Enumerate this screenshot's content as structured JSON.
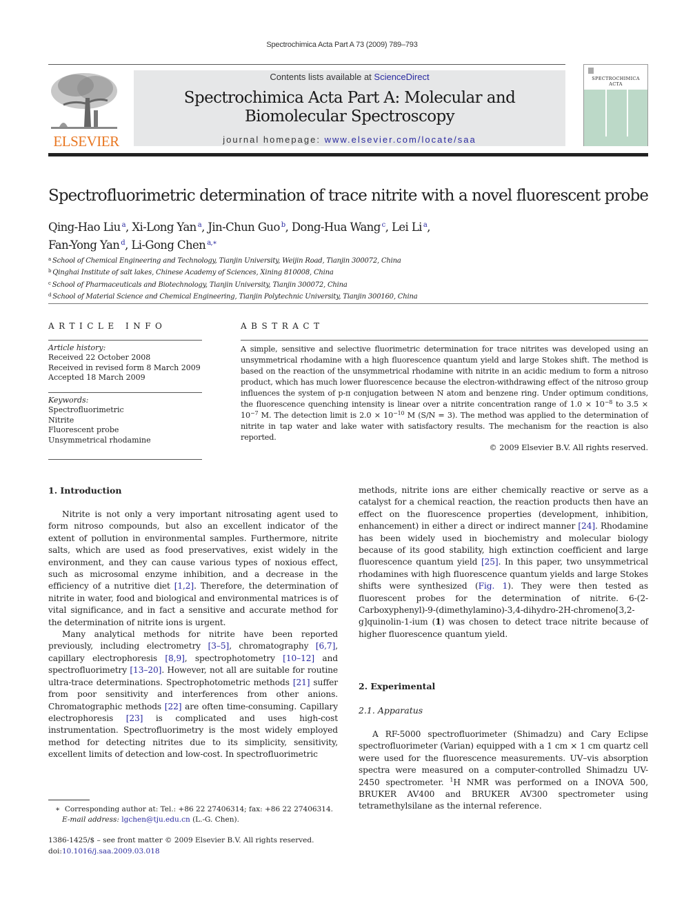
{
  "running_head": "Spectrochimica Acta Part A 73 (2009) 789–793",
  "publisher": {
    "logo_wordmark": "ELSEVIER",
    "brand_color": "#e87722"
  },
  "banner": {
    "contents_prefix": "Contents lists available at ",
    "contents_link": "ScienceDirect",
    "journal_title_line1": "Spectrochimica Acta Part A: Molecular and",
    "journal_title_line2": "Biomolecular Spectroscopy",
    "homepage_prefix": "journal homepage: ",
    "homepage_link": "www.elsevier.com/locate/saa",
    "background_color": "#e6e7e8",
    "link_color": "#2a2aa0"
  },
  "cover": {
    "title_line1": "SPECTROCHIMICA",
    "title_line2": "ACTA",
    "body_color": "#bcd9c8"
  },
  "article": {
    "title": "Spectrofluorimetric determination of trace nitrite with a novel fluorescent probe",
    "authors": [
      {
        "name": "Qing-Hao Liu",
        "aff": "a",
        "sep": ", "
      },
      {
        "name": "Xi-Long Yan",
        "aff": "a",
        "sep": ", "
      },
      {
        "name": "Jin-Chun Guo",
        "aff": "b",
        "sep": ", "
      },
      {
        "name": "Dong-Hua Wang",
        "aff": "c",
        "sep": ", "
      },
      {
        "name": "Lei Li",
        "aff": "a",
        "sep": ","
      },
      {
        "name": "Fan-Yong Yan",
        "aff": "d",
        "sep": ", "
      },
      {
        "name": "Li-Gong Chen",
        "aff": "a,∗",
        "sep": ""
      }
    ],
    "affiliations": [
      {
        "key": "a",
        "text": "School of Chemical Engineering and Technology, Tianjin University, Weijin Road, Tianjin 300072, China"
      },
      {
        "key": "b",
        "text": "Qinghai Institute of salt lakes, Chinese Academy of Sciences, Xining 810008, China"
      },
      {
        "key": "c",
        "text": "School of Pharmaceuticals and Biotechnology, Tianjin University, Tianjin 300072, China"
      },
      {
        "key": "d",
        "text": "School of Material Science and Chemical Engineering, Tianjin Polytechnic University, Tianjin 300160, China"
      }
    ]
  },
  "article_info": {
    "heading": "ARTICLE INFO",
    "history_label": "Article history:",
    "history": [
      "Received 22 October 2008",
      "Received in revised form 8 March 2009",
      "Accepted 18 March 2009"
    ],
    "keywords_label": "Keywords:",
    "keywords": [
      "Spectrofluorimetric",
      "Nitrite",
      "Fluorescent probe",
      "Unsymmetrical rhodamine"
    ]
  },
  "abstract": {
    "heading": "ABSTRACT",
    "text_part1": "A simple, sensitive and selective fluorimetric determination for trace nitrites was developed using an unsymmetrical rhodamine with a high fluorescence quantum yield and large Stokes shift. The method is based on the reaction of the unsymmetrical rhodamine with nitrite in an acidic medium to form a nitroso product, which has much lower fluorescence because the electron-withdrawing effect of the nitroso group influences the system of p-π conjugation between N atom and benzene ring. Under optimum conditions, the fluorescence quenching intensity is linear over a nitrite concentration range of 1.0 × 10",
    "exp1": "−8",
    "text_part2": " to 3.5 × 10",
    "exp2": "−7",
    "text_part3": " M. The detection limit is 2.0 × 10",
    "exp3": "−10",
    "text_part4": " M (S/N = 3). The method was applied to the determination of nitrite in tap water and lake water with satisfactory results. The mechanism for the reaction is also reported.",
    "copyright": "© 2009 Elsevier B.V. All rights reserved."
  },
  "body": {
    "section1_heading": "1.  Introduction",
    "intro_p1": {
      "a": "Nitrite is not only a very important nitrosating agent used to form nitroso compounds, but also an excellent indicator of the extent of pollution in environmental samples. Furthermore, nitrite salts, which are used as food preservatives, exist widely in the environment, and they can cause various types of noxious effect, such as microsomal enzyme inhibition, and a decrease in the efficiency of a nutritive diet ",
      "ref1": "[1,2]",
      "b": ". Therefore, the determination of nitrite in water, food and biological and environmental matrices is of vital significance, and in fact a sensitive and accurate method for the determination of nitrite ions is urgent."
    },
    "intro_p2": {
      "a": "Many analytical methods for nitrite have been reported previously, including electrometry ",
      "ref1": "[3–5]",
      "b": ", chromatography ",
      "ref2": "[6,7]",
      "c": ", capillary electrophoresis ",
      "ref3": "[8,9]",
      "d": ", spectrophotometry ",
      "ref4": "[10–12]",
      "e": " and spectrofluorimetry ",
      "ref5": "[13–20]",
      "f": ". However, not all are suitable for routine ultra-trace determinations. Spectrophotometric methods ",
      "ref6": "[21]",
      "g": " suffer from poor sensitivity and interferences from other anions. Chromatographic methods ",
      "ref7": "[22]",
      "h": " are often time-consuming. Capillary electrophoresis ",
      "ref8": "[23]",
      "i": " is complicated and uses high-cost instrumentation. Spectrofluorimetry is the most widely employed method for detecting nitrites due to its simplicity, sensitivity, excellent limits of detection and low-cost. In spectrofluorimetric"
    },
    "intro_p2_cont": {
      "a": "methods, nitrite ions are either chemically reactive or serve as a catalyst for a chemical reaction, the reaction products then have an effect on the fluorescence properties (development, inhibition, enhancement) in either a direct or indirect manner ",
      "ref1": "[24]",
      "b": ". Rhodamine has been widely used in biochemistry and molecular biology because of its good stability, high extinction coefficient and large fluorescence quantum yield ",
      "ref2": "[25]",
      "c": ". In this paper, two unsymmetrical rhodamines with high fluorescence quantum yields and large Stokes shifts were synthesized (",
      "ref3": "Fig. 1",
      "d": "). They were then tested as fluorescent probes for the determination of nitrite. 6-(2-Carboxyphenyl)-9-(dimethylamino)-3,4-dihydro-2H-chromeno[3,2-g]quinolin-1-ium (",
      "bold": "1",
      "e": ") was chosen to detect trace nitrite because of higher fluorescence quantum yield."
    },
    "section2_heading": "2.  Experimental",
    "subsection21_heading": "2.1.  Apparatus",
    "apparatus": {
      "a": "A RF-5000 spectrofluorimeter (Shimadzu) and Cary Eclipse spectrofluorimeter (Varian) equipped with a 1 cm × 1 cm quartz cell were used for the fluorescence measurements. UV–vis absorption spectra were measured on a computer-controlled Shimadzu UV-2450 spectrometer. ",
      "sup": "1",
      "b": "H NMR was performed on a INOVA 500, BRUKER AV400 and BRUKER AV300 spectrometer using tetramethylsilane as the internal reference."
    }
  },
  "footnote": {
    "marker": "∗",
    "text": "Corresponding author at: Tel.: +86 22 27406314; fax: +86 22 27406314.",
    "email_label": "E-mail address:",
    "email": "lgchen@tju.edu.cn",
    "email_suffix": " (L.-G. Chen)."
  },
  "front_matter": {
    "issn_line": "1386-1425/$ – see front matter © 2009 Elsevier B.V. All rights reserved.",
    "doi_prefix": "doi:",
    "doi": "10.1016/j.saa.2009.03.018"
  }
}
